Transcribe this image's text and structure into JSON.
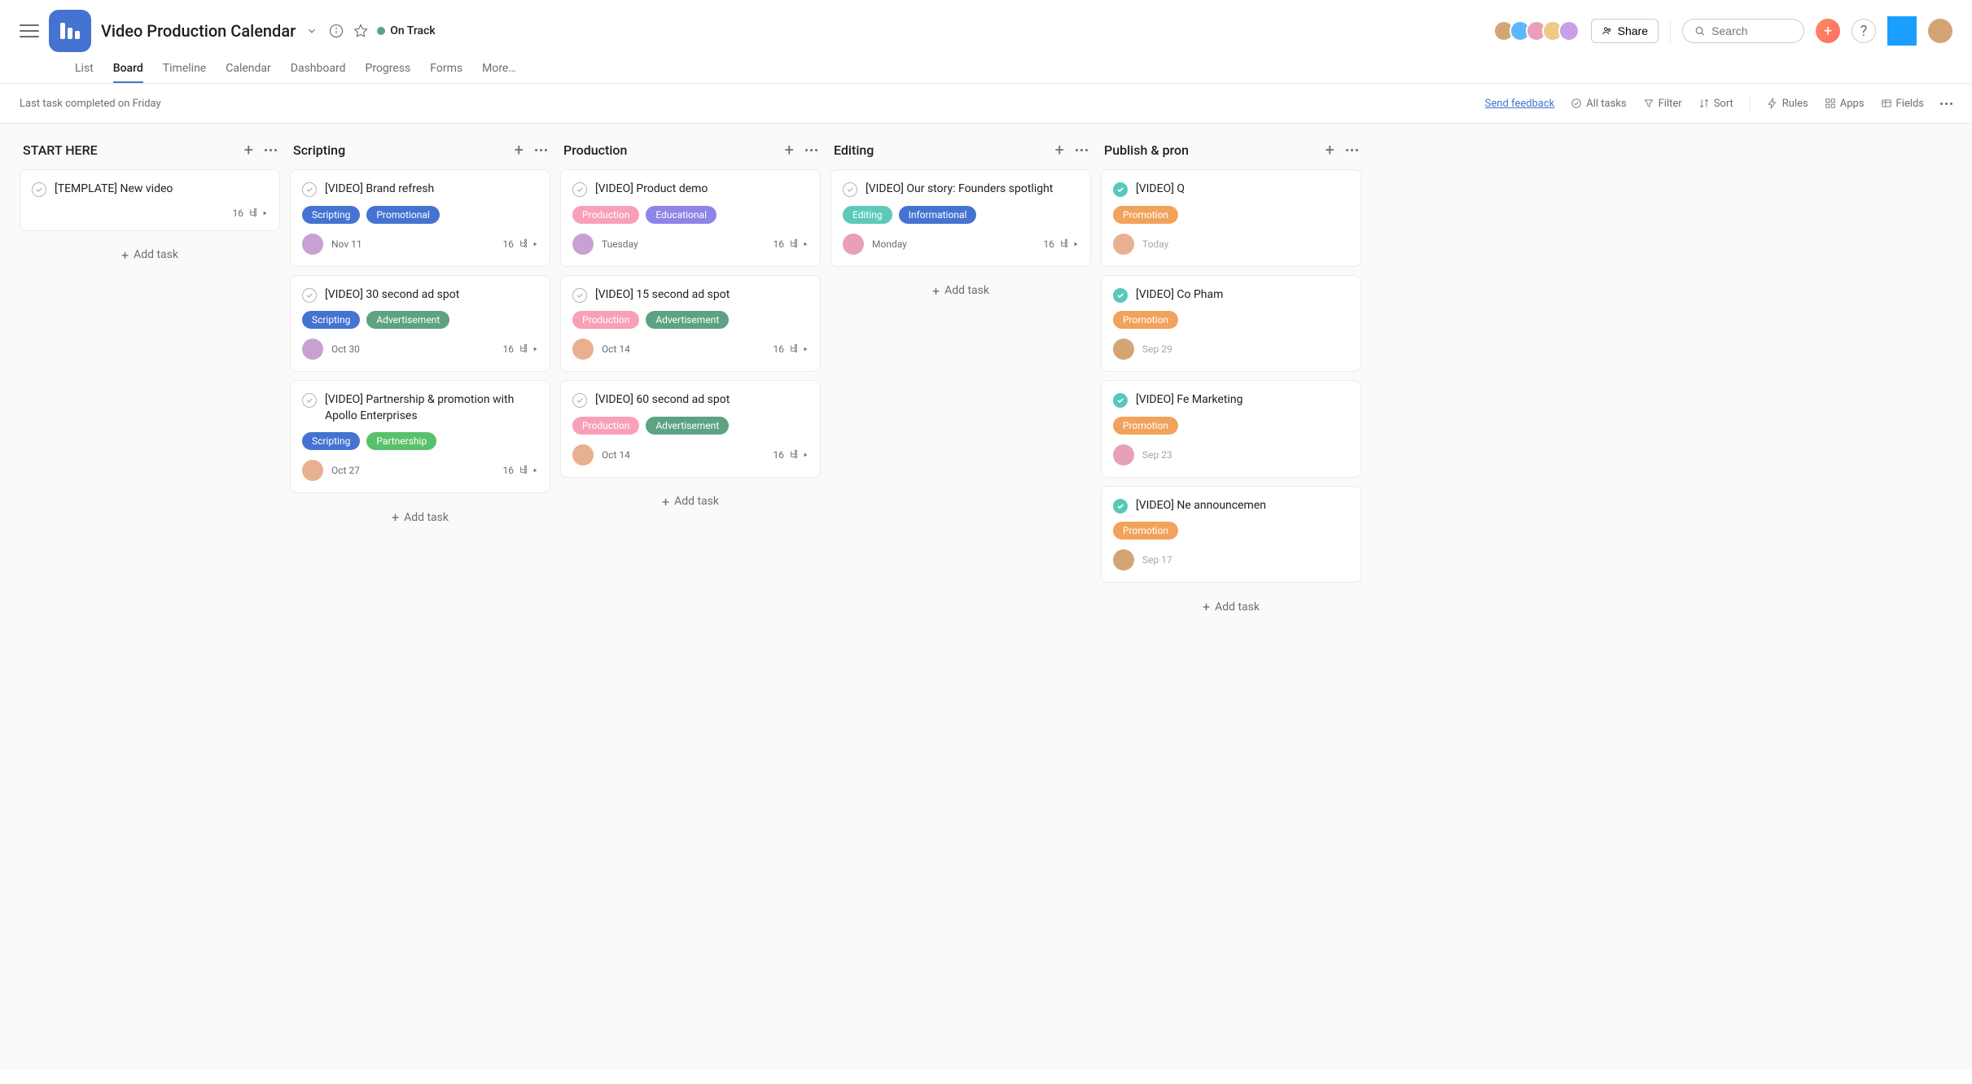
{
  "header": {
    "title": "Video Production Calendar",
    "status_label": "On Track",
    "status_color": "#5da283",
    "share_label": "Share",
    "search_placeholder": "Search",
    "tabs": [
      "List",
      "Board",
      "Timeline",
      "Calendar",
      "Dashboard",
      "Progress",
      "Forms",
      "More…"
    ],
    "active_tab": 1,
    "avatar_colors": [
      "#d4a574",
      "#5bb8ff",
      "#e8a0b8",
      "#f0c987",
      "#c9a0e8"
    ]
  },
  "toolbar": {
    "last_task": "Last task completed on Friday",
    "feedback": "Send feedback",
    "all_tasks": "All tasks",
    "filter": "Filter",
    "sort": "Sort",
    "rules": "Rules",
    "apps": "Apps",
    "fields": "Fields"
  },
  "tag_colors": {
    "Scripting": {
      "bg": "#4573d2",
      "fg": "#fff"
    },
    "Promotional": {
      "bg": "#4573d2",
      "fg": "#fff"
    },
    "Advertisement": {
      "bg": "#5da283",
      "fg": "#fff"
    },
    "Partnership": {
      "bg": "#5ac16b",
      "fg": "#fff"
    },
    "Production": {
      "bg": "#f8a0b8",
      "fg": "#fff"
    },
    "Educational": {
      "bg": "#8d84e8",
      "fg": "#fff"
    },
    "Editing": {
      "bg": "#5dc9b9",
      "fg": "#fff"
    },
    "Informational": {
      "bg": "#4573d2",
      "fg": "#fff"
    },
    "Promotion": {
      "bg": "#f1a35c",
      "fg": "#fff"
    }
  },
  "avatar_palette": {
    "a1": "#c9a0d4",
    "a2": "#e8b090",
    "a3": "#8ab8d4",
    "a4": "#d4a574",
    "a5": "#e8a0b8"
  },
  "columns": [
    {
      "title": "START HERE",
      "cards": [
        {
          "title": "[TEMPLATE] New video",
          "tags": [],
          "date": "",
          "subtasks": "16",
          "avatar": "",
          "done": false,
          "show_footer_simple": true
        }
      ]
    },
    {
      "title": "Scripting",
      "cards": [
        {
          "title": "[VIDEO] Brand refresh",
          "tags": [
            "Scripting",
            "Promotional"
          ],
          "date": "Nov 11",
          "subtasks": "16",
          "avatar": "a1",
          "done": false
        },
        {
          "title": "[VIDEO] 30 second ad spot",
          "tags": [
            "Scripting",
            "Advertisement"
          ],
          "date": "Oct 30",
          "subtasks": "16",
          "avatar": "a1",
          "done": false
        },
        {
          "title": "[VIDEO] Partnership & promotion with Apollo Enterprises",
          "tags": [
            "Scripting",
            "Partnership"
          ],
          "date": "Oct 27",
          "subtasks": "16",
          "avatar": "a2",
          "done": false
        }
      ]
    },
    {
      "title": "Production",
      "cards": [
        {
          "title": "[VIDEO] Product demo",
          "tags": [
            "Production",
            "Educational"
          ],
          "date": "Tuesday",
          "subtasks": "16",
          "avatar": "a1",
          "done": false
        },
        {
          "title": "[VIDEO] 15 second ad spot",
          "tags": [
            "Production",
            "Advertisement"
          ],
          "date": "Oct 14",
          "subtasks": "16",
          "avatar": "a2",
          "done": false
        },
        {
          "title": "[VIDEO] 60 second ad spot",
          "tags": [
            "Production",
            "Advertisement"
          ],
          "date": "Oct 14",
          "subtasks": "16",
          "avatar": "a2",
          "done": false
        }
      ]
    },
    {
      "title": "Editing",
      "cards": [
        {
          "title": "[VIDEO] Our story: Founders spotlight",
          "tags": [
            "Editing",
            "Informational"
          ],
          "date": "Monday",
          "subtasks": "16",
          "avatar": "a5",
          "done": false
        }
      ]
    },
    {
      "title": "Publish & pron",
      "cards": [
        {
          "title": "[VIDEO] Q",
          "tags": [
            "Promotion"
          ],
          "date": "Today",
          "subtasks": "",
          "avatar": "a2",
          "done": true
        },
        {
          "title": "[VIDEO] Co Pham",
          "tags": [
            "Promotion"
          ],
          "date": "Sep 29",
          "subtasks": "",
          "avatar": "a4",
          "done": true
        },
        {
          "title": "[VIDEO] Fe Marketing",
          "tags": [
            "Promotion"
          ],
          "date": "Sep 23",
          "subtasks": "",
          "avatar": "a5",
          "done": true
        },
        {
          "title": "[VIDEO] Ne announcemen",
          "tags": [
            "Promotion"
          ],
          "date": "Sep 17",
          "subtasks": "",
          "avatar": "a4",
          "done": true
        }
      ]
    }
  ],
  "add_task_label": "Add task"
}
